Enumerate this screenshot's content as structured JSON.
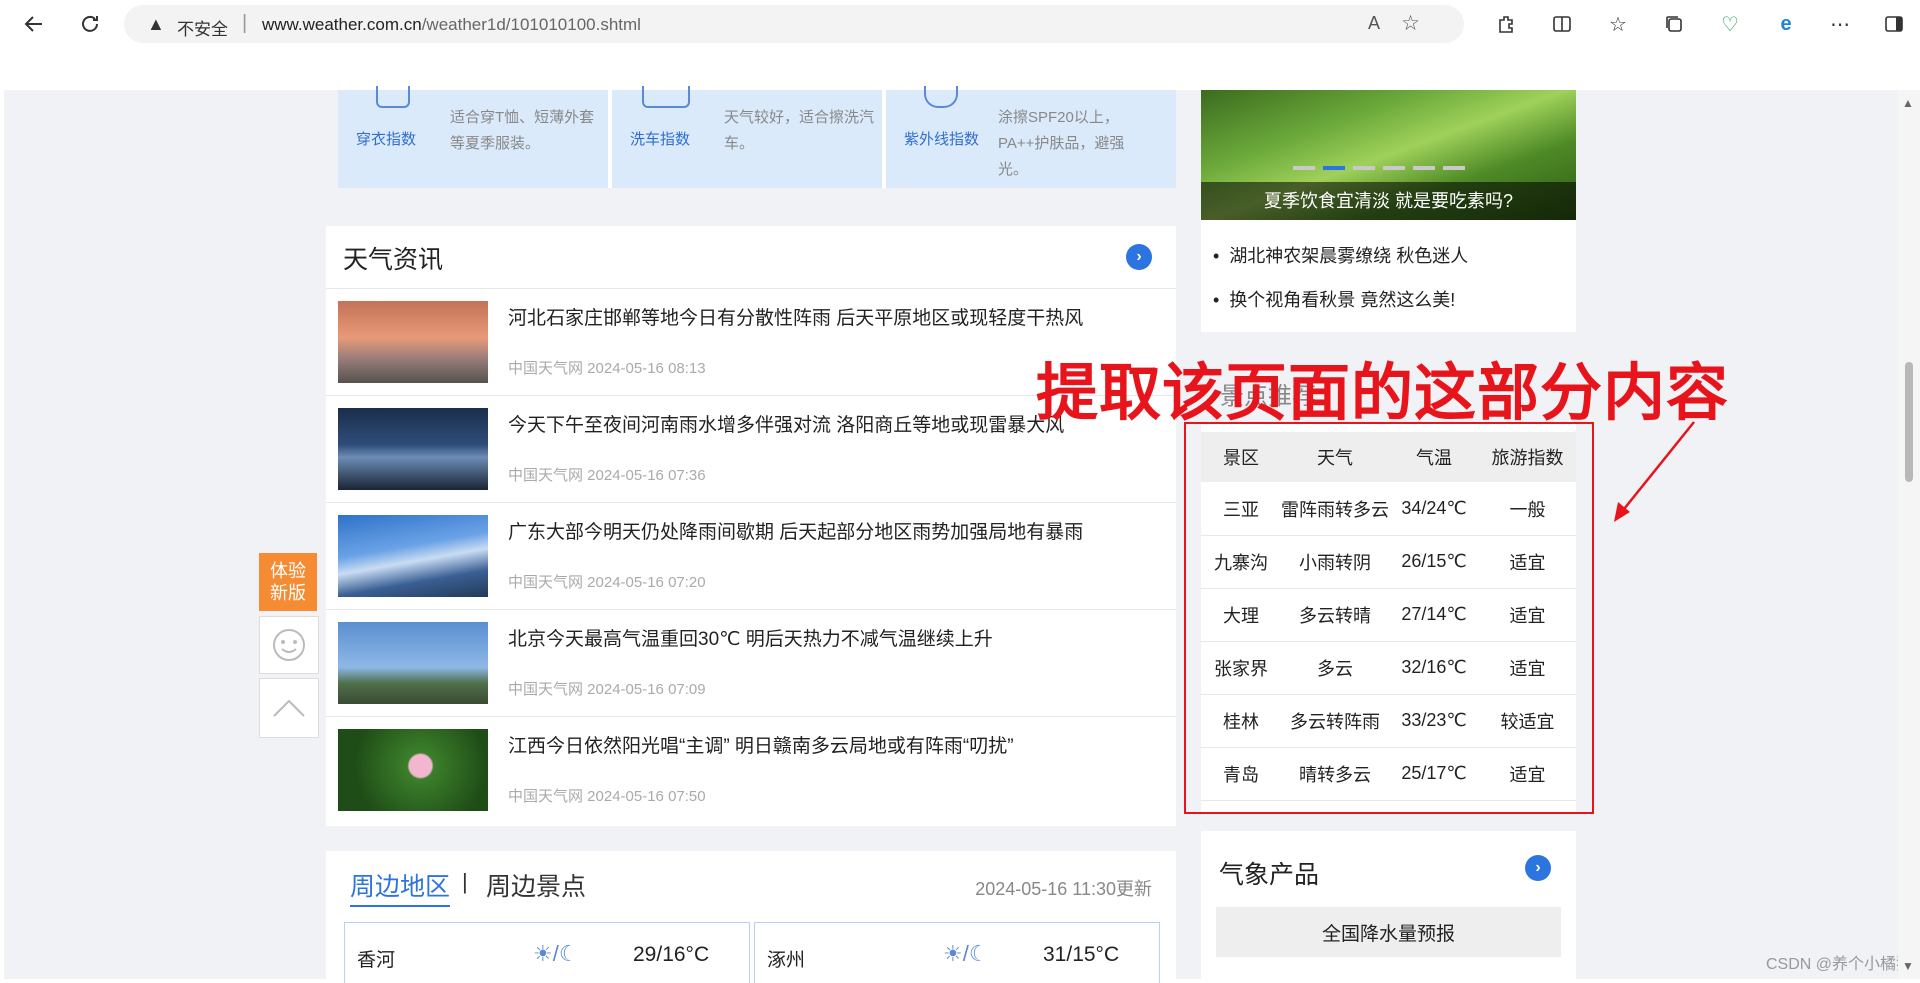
{
  "browser": {
    "insecure_label": "不安全",
    "url_host": "www.weather.com.cn",
    "url_path": "/weather1d/101010100.shtml",
    "read_aloud": "A⁾",
    "icons": [
      "back-icon",
      "refresh-icon",
      "warning-icon",
      "read-aloud-icon",
      "favorite-icon",
      "extensions-icon",
      "split-screen-icon",
      "favorites-list-icon",
      "collections-icon",
      "health-icon",
      "edge-icon",
      "more-icon",
      "sidebar-icon"
    ]
  },
  "life_index": [
    {
      "label": "穿衣指数",
      "desc": "适合穿T恤、短薄外套等夏季服装。"
    },
    {
      "label": "洗车指数",
      "desc": "天气较好，适合擦洗汽车。"
    },
    {
      "label": "紫外线指数",
      "desc": "涂擦SPF20以上，PA++护肤品，避强光。"
    }
  ],
  "news": {
    "title": "天气资讯",
    "items": [
      {
        "headline": "河北石家庄邯郸等地今日有分散性阵雨 后天平原地区或现轻度干热风",
        "meta": "中国天气网 2024-05-16 08:13"
      },
      {
        "headline": "今天下午至夜间河南雨水增多伴强对流 洛阳商丘等地或现雷暴大风",
        "meta": "中国天气网 2024-05-16 07:36"
      },
      {
        "headline": "广东大部今明天仍处降雨间歇期 后天起部分地区雨势加强局地有暴雨",
        "meta": "中国天气网 2024-05-16 07:20"
      },
      {
        "headline": "北京今天最高气温重回30℃ 明后天热力不减气温继续上升",
        "meta": "中国天气网 2024-05-16 07:09"
      },
      {
        "headline": "江西今日依然阳光唱“主调” 明日赣南多云局地或有阵雨“叨扰”",
        "meta": "中国天气网 2024-05-16 07:50"
      }
    ]
  },
  "side_buttons": {
    "try_new": "体验\n新版"
  },
  "nearby": {
    "tab_area": "周边地区",
    "tab_sep": "|",
    "tab_scenic": "周边景点",
    "updated": "2024-05-16 11:30更新",
    "cities": [
      {
        "name": "香河",
        "weather_sep": "/",
        "temp": "29/16°C"
      },
      {
        "name": "涿州",
        "weather_sep": "/",
        "temp": "31/15°C"
      }
    ]
  },
  "feature": {
    "caption": "夏季饮食宜清淡 就是要吃素吗?",
    "links": [
      "湖北神农架晨雾缭绕 秋色迷人",
      "换个视角看秋景 竟然这么美!"
    ]
  },
  "annotation": {
    "text": "提取该页面的这部分内容",
    "color": "#e8141c"
  },
  "scenic": {
    "heading": "景点推荐",
    "columns": [
      "景区",
      "天气",
      "气温",
      "旅游指数"
    ],
    "rows": [
      [
        "三亚",
        "雷阵雨转多云",
        "34/24℃",
        "一般"
      ],
      [
        "九寨沟",
        "小雨转阴",
        "26/15℃",
        "适宜"
      ],
      [
        "大理",
        "多云转晴",
        "27/14℃",
        "适宜"
      ],
      [
        "张家界",
        "多云",
        "32/16℃",
        "适宜"
      ],
      [
        "桂林",
        "多云转阵雨",
        "33/23℃",
        "较适宜"
      ],
      [
        "青岛",
        "晴转多云",
        "25/17℃",
        "适宜"
      ]
    ]
  },
  "products": {
    "title": "气象产品",
    "first": "全国降水量预报"
  },
  "watermark": "CSDN @养个小橘猫",
  "colors": {
    "accent": "#2c74e0",
    "annotation_red": "#e8141c",
    "try_new_orange": "#f58b33"
  }
}
